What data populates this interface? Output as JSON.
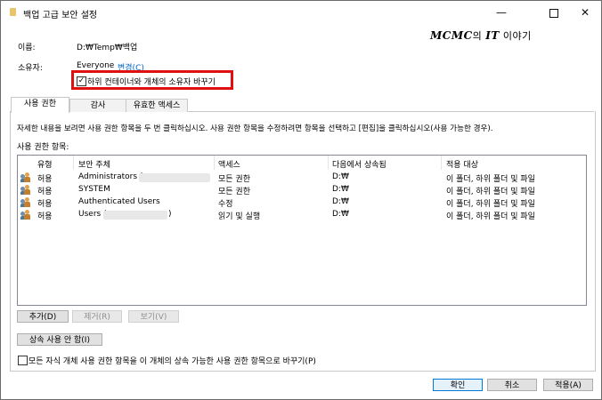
{
  "window": {
    "title": "백업 고급 보안 설정",
    "minimize": "—",
    "close": "✕"
  },
  "watermark": {
    "brand": "MCMC",
    "mid": "의 ",
    "it": "IT",
    "rest": " 이야기"
  },
  "info": {
    "name_label": "이름:",
    "name_value": "D:₩Temp₩백업",
    "owner_label": "소유자:",
    "owner_value": "Everyone",
    "owner_change_link": "변경(C)",
    "replace_owner_checkbox": {
      "label": "하위 컨테이너와 개체의 소유자 바꾸기",
      "checked": true
    }
  },
  "tabs": [
    {
      "label": "사용 권한",
      "active": true
    },
    {
      "label": "감사",
      "active": false
    },
    {
      "label": "유효한 액세스",
      "active": false
    }
  ],
  "instructions": "자세한 내용을 보려면 사용 권한 항목을 두 번 클릭하십시오. 사용 권한 항목을 수정하려면 항목을 선택하고 [편집]을 클릭하십시오(사용 가능한 경우).",
  "entries_label": "사용 권한 항목:",
  "table": {
    "columns": [
      "유형",
      "보안 주체",
      "액세스",
      "다음에서 상속됨",
      "적용 대상"
    ],
    "rows": [
      {
        "type": "허용",
        "principal": "Administrators (",
        "access": "모든 권한",
        "inherited": "D:₩",
        "applies": "이 폴더, 하위 폴더 및 파일"
      },
      {
        "type": "허용",
        "principal": "SYSTEM",
        "access": "모든 권한",
        "inherited": "D:₩",
        "applies": "이 폴더, 하위 폴더 및 파일"
      },
      {
        "type": "허용",
        "principal": "Authenticated Users",
        "access": "수정",
        "inherited": "D:₩",
        "applies": "이 폴더, 하위 폴더 및 파일"
      },
      {
        "type": "허용",
        "principal": "Users (",
        "principal_end": ")",
        "access": "읽기 및 실행",
        "inherited": "D:₩",
        "applies": "이 폴더, 하위 폴더 및 파일"
      }
    ]
  },
  "buttons": {
    "add": "추가(D)",
    "remove": "제거(R)",
    "view": "보기(V)",
    "disable_inheritance": "상속 사용 안 함(I)",
    "ok": "확인",
    "cancel": "취소",
    "apply": "적용(A)"
  },
  "replace_child_checkbox": {
    "label": "모든 자식 개체 사용 권한 항목을 이 개체의 상속 가능한 사용 권한 항목으로 바꾸기(P)",
    "checked": false
  },
  "icons": {
    "folder": "folder-icon",
    "user": "user-group-icon"
  }
}
